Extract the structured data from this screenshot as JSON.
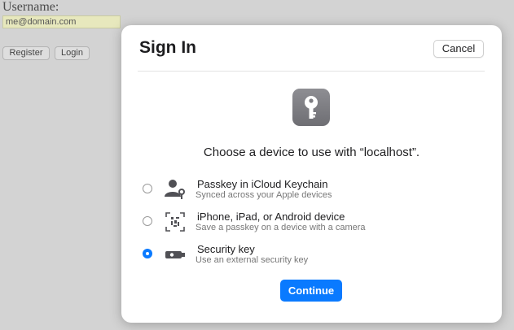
{
  "background_page": {
    "username_label": "Username:",
    "username_value": "me@domain.com",
    "register_label": "Register",
    "login_label": "Login"
  },
  "dialog": {
    "title": "Sign In",
    "cancel_label": "Cancel",
    "app_icon": "key-icon",
    "heading": "Choose a device to use with “localhost”.",
    "options": [
      {
        "title": "Passkey in iCloud Keychain",
        "subtitle": "Synced across your Apple devices",
        "icon": "person-key-icon",
        "selected": false
      },
      {
        "title": "iPhone, iPad, or Android device",
        "subtitle": "Save a passkey on a device with a camera",
        "icon": "qr-code-icon",
        "selected": false
      },
      {
        "title": "Security key",
        "subtitle": "Use an external security key",
        "icon": "security-key-icon",
        "selected": true
      }
    ],
    "continue_label": "Continue"
  },
  "colors": {
    "accent": "#0a7aff",
    "overlay": "#d3d3d3",
    "input_fill": "#e7e8bd"
  }
}
